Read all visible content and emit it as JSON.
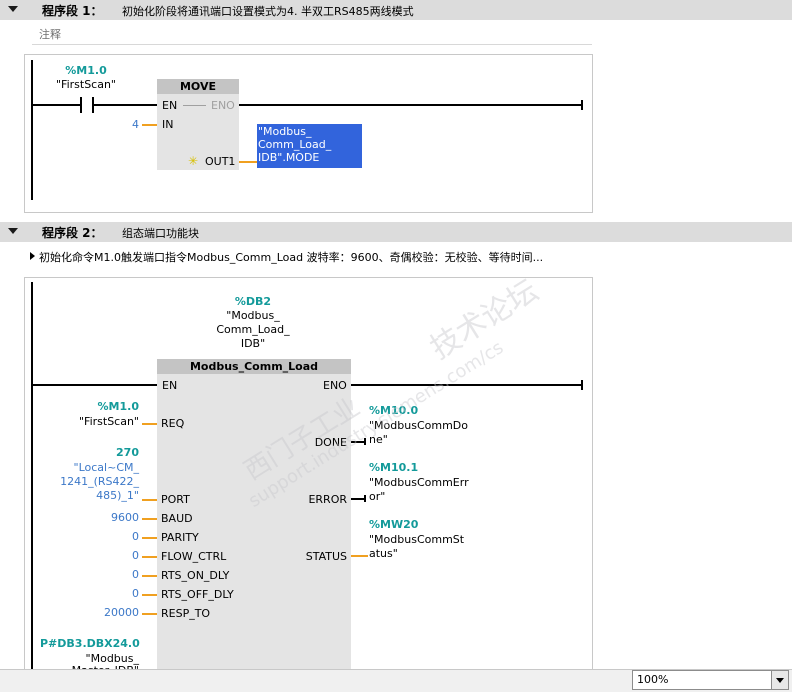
{
  "network1": {
    "label": "程序段 1：",
    "title": "初始化阶段将通讯端口设置模式为4. 半双工RS485两线模式",
    "comment": "注释",
    "contact": {
      "address": "%M1.0",
      "symbol": "\"FirstScan\""
    },
    "block": {
      "name": "MOVE",
      "en": "EN",
      "eno": "ENO",
      "in_pin": "IN",
      "in_value": "4",
      "out_pin": "OUT1",
      "out_line1": "\"Modbus_",
      "out_line2": "Comm_Load_",
      "out_line3": "IDB\".MODE"
    }
  },
  "network2": {
    "label": "程序段 2：",
    "title": "组态端口功能块",
    "comment": "初始化命令M1.0触发端口指令Modbus_Comm_Load  波特率：9600、奇偶校验：无校验、等待时间...",
    "instance": {
      "address": "%DB2",
      "line1": "\"Modbus_",
      "line2": "Comm_Load_",
      "line3": "IDB\""
    },
    "block": {
      "name": "Modbus_Comm_Load",
      "en": "EN",
      "eno": "ENO"
    },
    "inputs": [
      {
        "pin": "REQ",
        "address": "%M1.0",
        "value": "\"FirstScan\""
      },
      {
        "pin": "PORT",
        "address": "270",
        "line1": "\"Local~CM_",
        "line2": "1241_(RS422_",
        "line3": "485)_1\""
      },
      {
        "pin": "BAUD",
        "value": "9600"
      },
      {
        "pin": "PARITY",
        "value": "0"
      },
      {
        "pin": "FLOW_CTRL",
        "value": "0"
      },
      {
        "pin": "RTS_ON_DLY",
        "value": "0"
      },
      {
        "pin": "RTS_OFF_DLY",
        "value": "0"
      },
      {
        "pin": "RESP_TO",
        "value": "20000"
      }
    ],
    "mb_db": {
      "address": "P#DB3.DBX24.0",
      "line1": "\"Modbus_",
      "line2": "Master_IDB\""
    },
    "outputs": [
      {
        "pin": "DONE",
        "address": "%M10.0",
        "line1": "\"ModbusCommDo",
        "line2": "ne\""
      },
      {
        "pin": "ERROR",
        "address": "%M10.1",
        "line1": "\"ModbusCommErr",
        "line2": "or\""
      },
      {
        "pin": "STATUS",
        "address": "%MW20",
        "line1": "\"ModbusCommSt",
        "line2": "atus\""
      }
    ]
  },
  "watermark": {
    "line1": "西门子工业",
    "line2": "support.industry.siemens.com/cs",
    "line3": "技术论坛"
  },
  "zoom": {
    "value": "100%"
  }
}
